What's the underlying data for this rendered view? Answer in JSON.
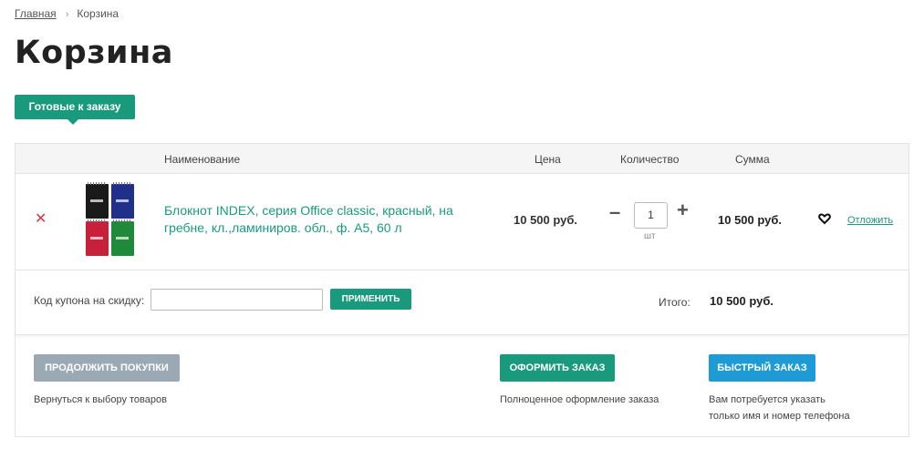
{
  "breadcrumb": {
    "home": "Главная",
    "separator": "›",
    "current": "Корзина"
  },
  "page_title": "Корзина",
  "tab": {
    "label": "Готовые к заказу"
  },
  "table_headers": {
    "name": "Наименование",
    "price": "Цена",
    "quantity": "Количество",
    "sum": "Сумма"
  },
  "item": {
    "name": "Блокнот INDEX, серия Office classic, красный, на гребне, кл.,ламиниров. обл., ф. А5, 60 л",
    "price": "10 500 руб.",
    "quantity": "1",
    "unit": "шт",
    "sum": "10 500 руб.",
    "postpone": "Отложить",
    "thumbnail_colors": [
      "#1a1a1a",
      "#1f2f8a",
      "#c8203a",
      "#1f8a3a"
    ]
  },
  "coupon": {
    "label": "Код купона на скидку:",
    "value": "",
    "apply": "ПРИМЕНИТЬ"
  },
  "total": {
    "label": "Итого:",
    "value": "10 500 руб."
  },
  "actions": {
    "continue": {
      "label": "ПРОДОЛЖИТЬ ПОКУПКИ",
      "hint": "Вернуться к выбору товаров"
    },
    "checkout": {
      "label": "ОФОРМИТЬ ЗАКАЗ",
      "hint": "Полноценное оформление заказа"
    },
    "quick": {
      "label": "БЫСТРЫЙ ЗАКАЗ",
      "hint_line1": "Вам потребуется указать",
      "hint_line2": "только имя и номер телефона"
    }
  },
  "colors": {
    "accent": "#1a9a7c",
    "quick": "#1e9bd6",
    "continue": "#9aa9b3",
    "delete": "#d9363e"
  },
  "icons": {
    "delete": "close-icon",
    "qty_minus": "minus-icon",
    "qty_plus": "plus-icon",
    "wishlist": "heart-icon"
  }
}
